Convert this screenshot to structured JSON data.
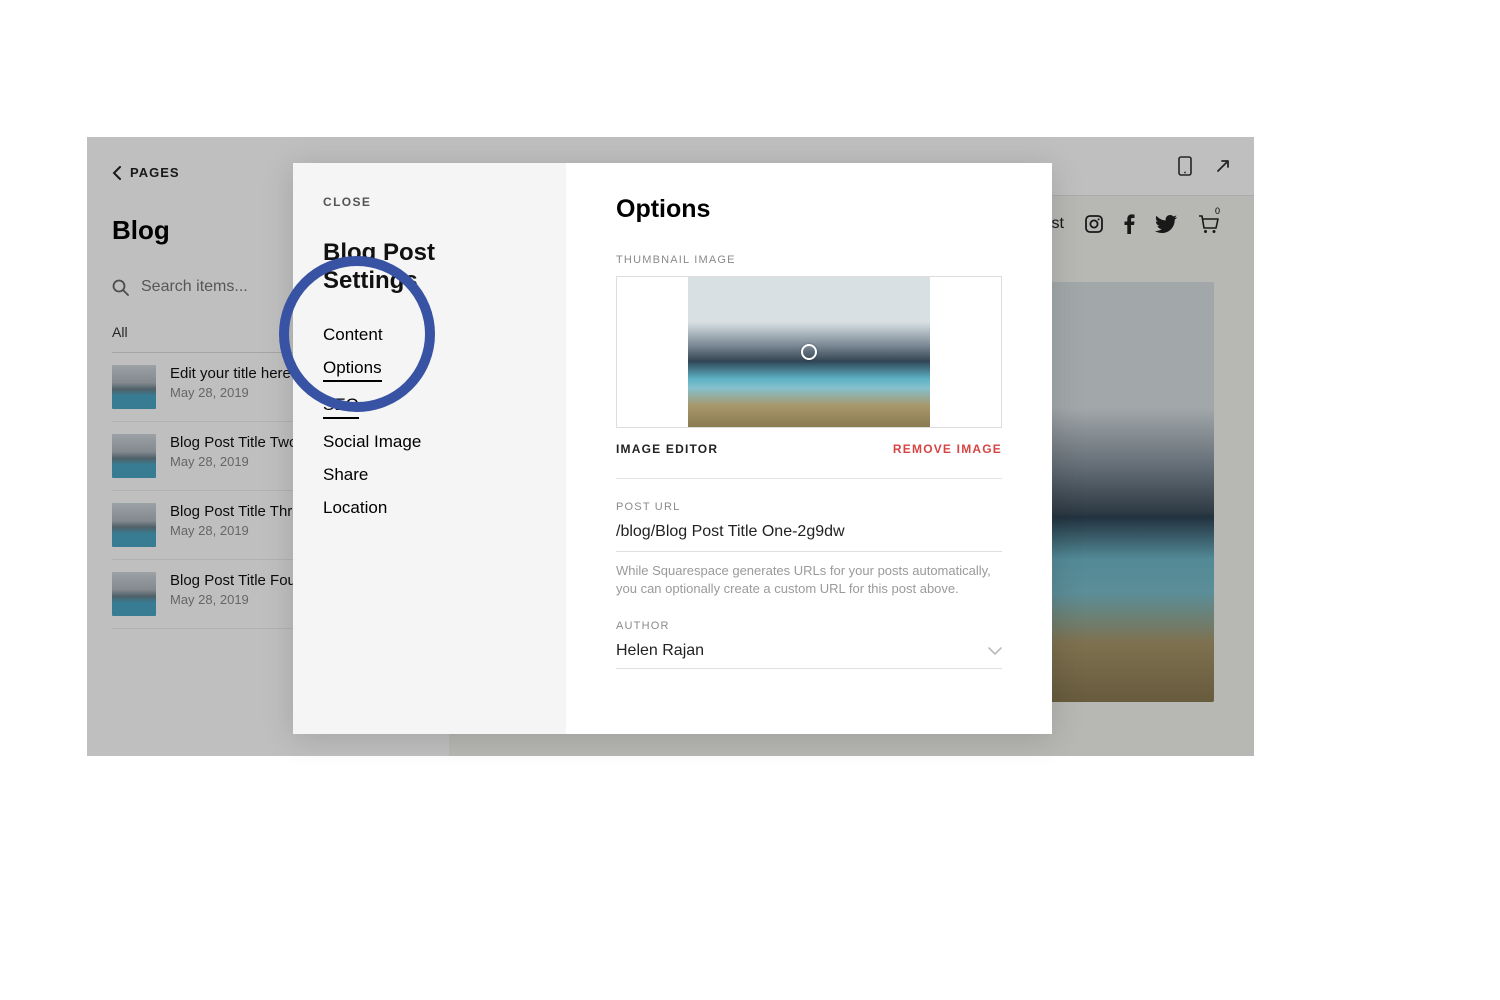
{
  "back_label": "PAGES",
  "sidebar": {
    "title": "Blog",
    "search_placeholder": "Search items...",
    "filter_all": "All",
    "items": [
      {
        "title": "Edit your title here",
        "date": "May 28, 2019"
      },
      {
        "title": "Blog Post Title Two",
        "date": "May 28, 2019"
      },
      {
        "title": "Blog Post Title Three",
        "date": "May 28, 2019"
      },
      {
        "title": "Blog Post Title Four",
        "date": "May 28, 2019"
      }
    ]
  },
  "sitebar": {
    "brand_text": "Test",
    "cart_count": "0"
  },
  "modal": {
    "close": "CLOSE",
    "title": "Blog Post Settings",
    "nav": {
      "content": "Content",
      "options": "Options",
      "seo": "SEO",
      "social": "Social Image",
      "share": "Share",
      "location": "Location"
    }
  },
  "options": {
    "heading": "Options",
    "thumb_label": "THUMBNAIL IMAGE",
    "image_editor": "IMAGE EDITOR",
    "remove_image": "REMOVE IMAGE",
    "post_url_label": "POST URL",
    "post_url_value": "/blog/Blog Post Title One-2g9dw",
    "url_helper": "While Squarespace generates URLs for your posts automatically, you can optionally create a custom URL for this post above.",
    "author_label": "AUTHOR",
    "author_value": "Helen Rajan"
  }
}
